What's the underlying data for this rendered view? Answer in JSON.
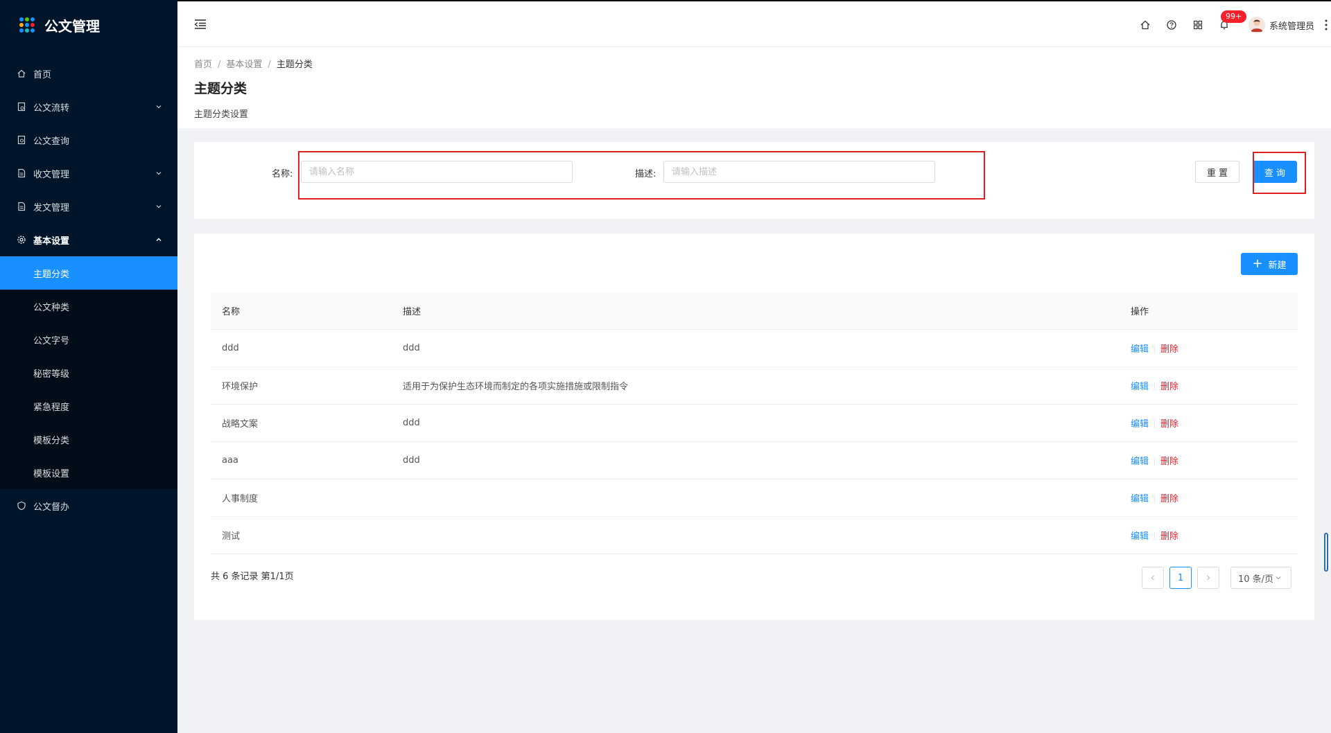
{
  "app": {
    "title": "公文管理"
  },
  "sidebar": {
    "items": [
      {
        "label": "首页",
        "icon": "home-icon"
      },
      {
        "label": "公文流转",
        "icon": "doc-flow-icon"
      },
      {
        "label": "公文查询",
        "icon": "doc-search-icon"
      },
      {
        "label": "收文管理",
        "icon": "doc-receive-icon"
      },
      {
        "label": "发文管理",
        "icon": "doc-send-icon"
      },
      {
        "label": "基本设置",
        "icon": "gear-icon"
      },
      {
        "label": "公文督办",
        "icon": "shield-icon"
      }
    ],
    "submenu": [
      {
        "label": "主题分类"
      },
      {
        "label": "公文种类"
      },
      {
        "label": "公文字号"
      },
      {
        "label": "秘密等级"
      },
      {
        "label": "紧急程度"
      },
      {
        "label": "模板分类"
      },
      {
        "label": "模板设置"
      }
    ]
  },
  "header": {
    "badge": "99+",
    "username": "系统管理员"
  },
  "breadcrumb": [
    "首页",
    "基本设置",
    "主题分类"
  ],
  "page": {
    "title": "主题分类",
    "desc": "主题分类设置"
  },
  "search": {
    "name_label": "名称:",
    "name_placeholder": "请输入名称",
    "desc_label": "描述:",
    "desc_placeholder": "请输入描述",
    "reset_label": "重 置",
    "query_label": "查 询"
  },
  "table": {
    "new_label": "新建",
    "columns": [
      "名称",
      "描述",
      "操作"
    ],
    "rows": [
      {
        "name": "ddd",
        "desc": "ddd"
      },
      {
        "name": "环境保护",
        "desc": "适用于为保护生态环境而制定的各项实施措施或限制指令"
      },
      {
        "name": "战略文案",
        "desc": "ddd"
      },
      {
        "name": "aaa",
        "desc": "ddd"
      },
      {
        "name": "人事制度",
        "desc": ""
      },
      {
        "name": "测试",
        "desc": ""
      }
    ],
    "edit_label": "编辑",
    "delete_label": "删除"
  },
  "pagination": {
    "total_text": "共 6 条记录 第1/1页",
    "current_page": "1",
    "page_size": "10 条/页"
  },
  "colors": {
    "accent": "#1890ff",
    "danger": "#f5222d",
    "sidebar": "#001529",
    "highlight": "#e02020"
  }
}
